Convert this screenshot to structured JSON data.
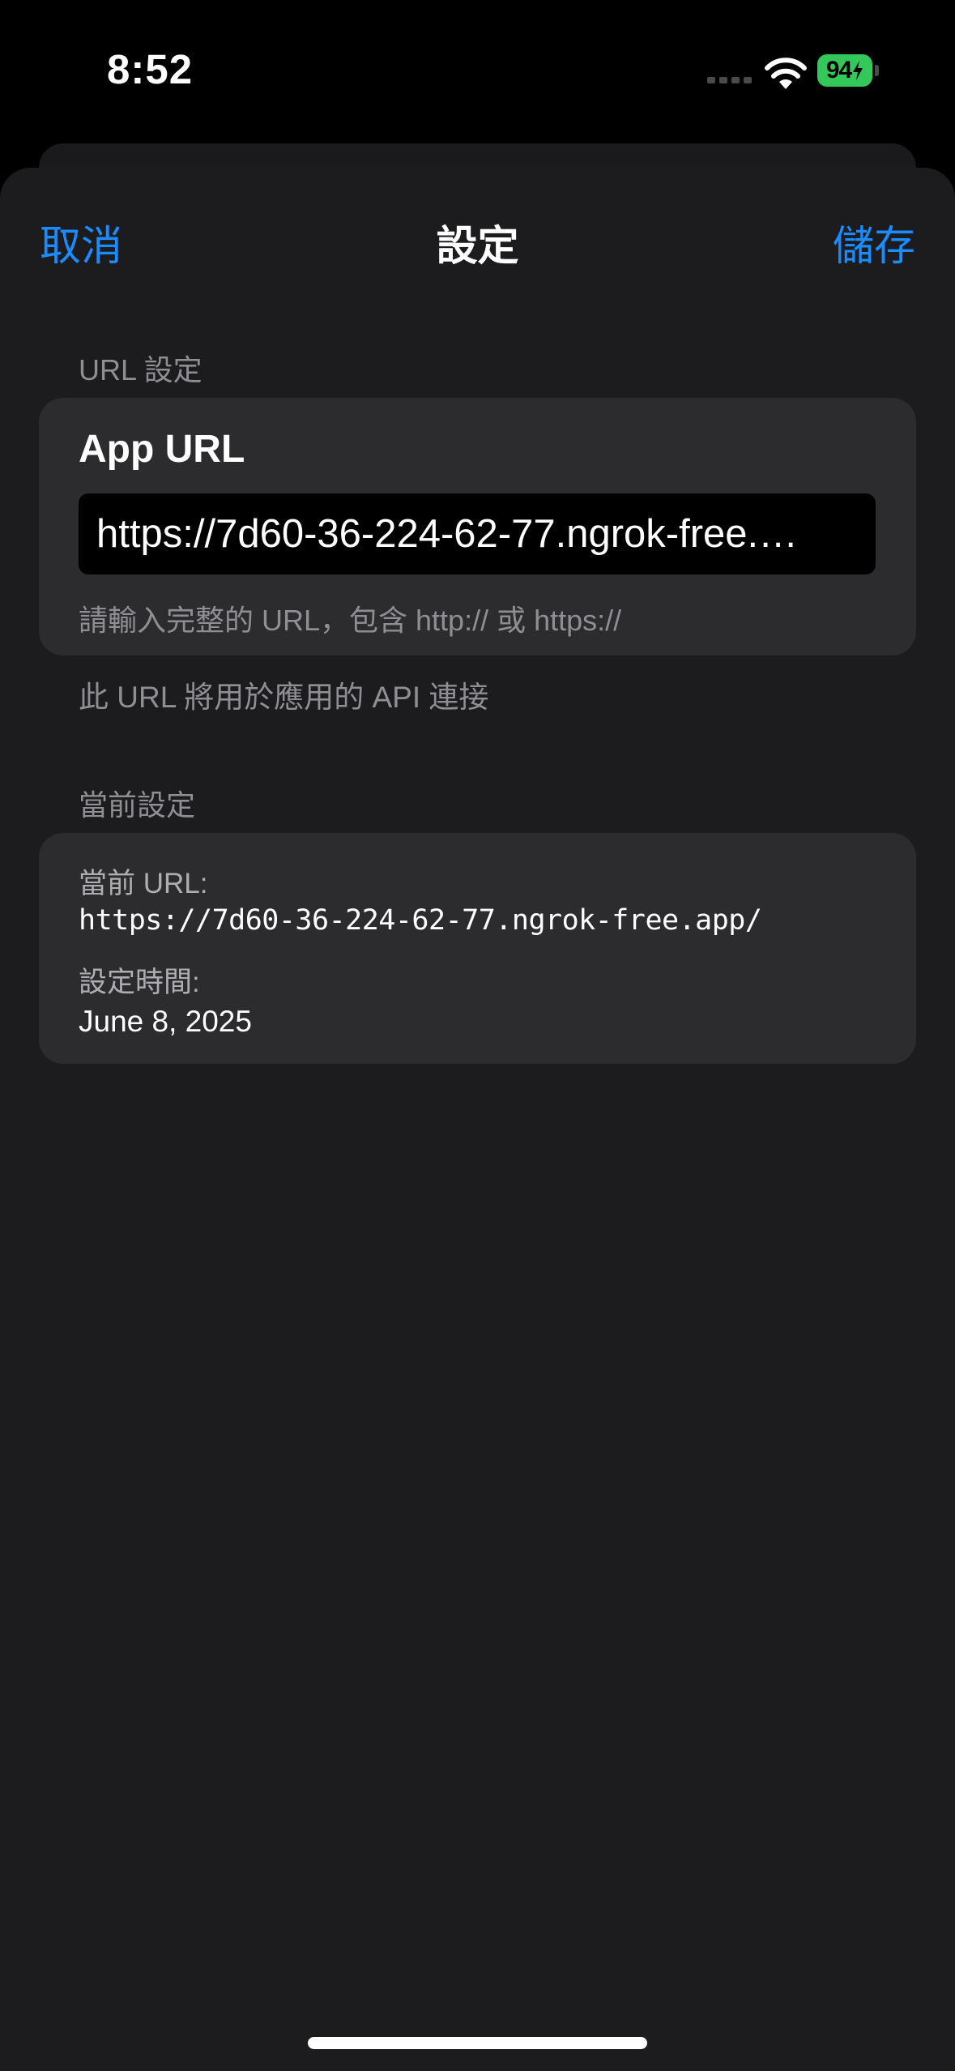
{
  "status_bar": {
    "time": "8:52",
    "battery_level": "94",
    "icons": [
      "signal-icon",
      "wifi-icon",
      "battery-charging-icon"
    ]
  },
  "nav": {
    "cancel_label": "取消",
    "title": "設定",
    "save_label": "儲存"
  },
  "url_section": {
    "header": "URL 設定",
    "field_title": "App URL",
    "input_value": "https://7d60-36-224-62-77.ngrok-free.…",
    "hint": "請輸入完整的 URL，包含 http:// 或 https://",
    "footer": "此 URL 將用於應用的 API 連接"
  },
  "current_section": {
    "header": "當前設定",
    "url_label": "當前 URL:",
    "url_value": "https://7d60-36-224-62-77.ngrok-free.app/",
    "time_label": "設定時間:",
    "time_value": "June 8, 2025"
  },
  "colors": {
    "accent": "#1a8cff",
    "battery": "#34c759",
    "sheet_background": "#1c1c1e",
    "card_background": "#2c2c2e"
  }
}
